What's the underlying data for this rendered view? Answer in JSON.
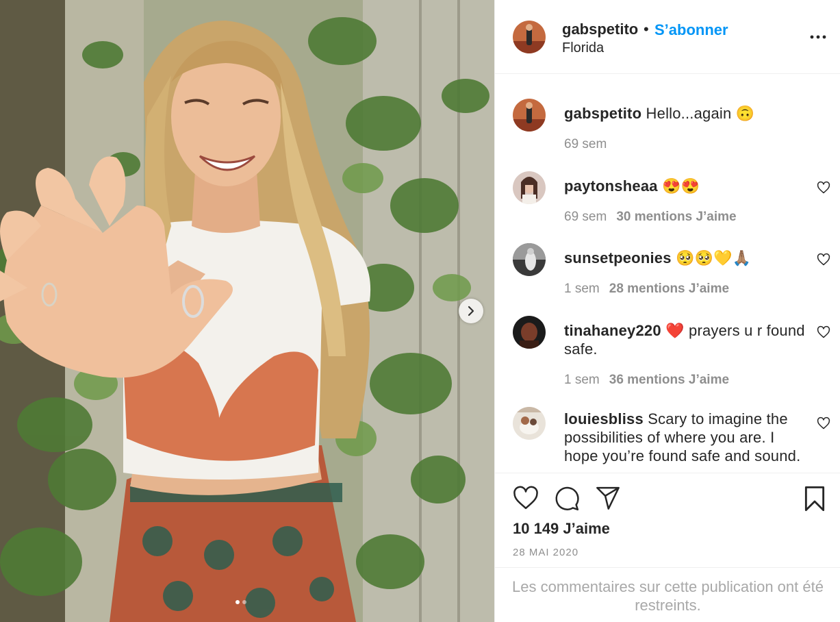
{
  "post": {
    "username": "gabspetito",
    "separator": "•",
    "follow_label": "S’abonner",
    "location": "Florida",
    "likes_total": "10 149 J’aime",
    "date": "28 MAI 2020",
    "restricted_notice": "Les commentaires sur cette publication ont été restreints."
  },
  "caption": {
    "username": "gabspetito",
    "text": "Hello...again 🙃",
    "time": "69 sem"
  },
  "comments": [
    {
      "username": "paytonsheaa",
      "text": "😍😍",
      "time": "69 sem",
      "likes": "30 mentions J’aime"
    },
    {
      "username": "sunsetpeonies",
      "text": "🥺🥺💛🙏🏽",
      "time": "1 sem",
      "likes": "28 mentions J’aime"
    },
    {
      "username": "tinahaney220",
      "text": "❤️ prayers u r found safe.",
      "time": "1 sem",
      "likes": "36 mentions J’aime"
    },
    {
      "username": "louiesbliss",
      "text": "Scary to imagine the possibilities of where you are. I hope you’re found safe and sound.",
      "time": "",
      "likes": ""
    }
  ],
  "icons": {
    "more": "more-options-icon",
    "like": "heart-icon",
    "comment": "comment-icon",
    "share": "send-icon",
    "save": "bookmark-icon",
    "next": "chevron-right-icon"
  },
  "colors": {
    "link": "#0095f6",
    "text": "#262626",
    "muted": "#8e8e8e",
    "divider": "#efefef"
  }
}
